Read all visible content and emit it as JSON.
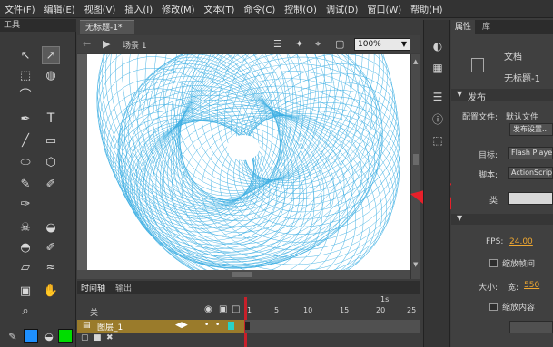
{
  "menubar": {
    "items": [
      "文件(F)",
      "编辑(E)",
      "视图(V)",
      "插入(I)",
      "修改(M)",
      "文本(T)",
      "命令(C)",
      "控制(O)",
      "调试(D)",
      "窗口(W)",
      "帮助(H)"
    ]
  },
  "tools_panel": {
    "title": "工具",
    "icons": [
      "selection-arrow-icon",
      "subselection-arrow-icon",
      "free-transform-icon",
      "3d-rotation-icon",
      "lasso-icon",
      "pen-icon",
      "text-icon",
      "line-icon",
      "rectangle-icon",
      "oval-icon",
      "polystar-icon",
      "pencil-icon",
      "brush-icon",
      "deco-brush-icon",
      "bone-icon",
      "paint-bucket-icon",
      "ink-bottle-icon",
      "eyedropper-icon",
      "eraser-icon",
      "width-tool-icon",
      "camera-icon",
      "hand-icon",
      "zoom-icon",
      "pencil-small-icon"
    ],
    "stroke_color": "#1e90ff",
    "fill_color": "#00dd00"
  },
  "document": {
    "tab_label": "无标题-1*",
    "scene_label": "场景 1",
    "zoom_value": "100%",
    "stage_color": "#ffffff",
    "spiro_color": "#2aa7e0"
  },
  "timeline": {
    "tabs": [
      "时间轴",
      "输出"
    ],
    "layer_folder": "关",
    "layer_name": "图层_1",
    "ruler_ticks": [
      "1",
      "5",
      "10",
      "15",
      "20",
      "25"
    ],
    "ruler_second": "1s"
  },
  "properties": {
    "tabs": [
      "属性",
      "库"
    ],
    "doc_type": "文档",
    "doc_name": "无标题-1",
    "section_publish": "发布",
    "profile_label": "配置文件:",
    "profile_value": "默认文件",
    "publish_settings_button": "发布设置...",
    "target_label": "目标:",
    "target_value": "Flash Player",
    "script_label": "脚本:",
    "script_value": "ActionScript",
    "class_label": "类:",
    "fps_label": "FPS:",
    "fps_value": "24.00",
    "scale_frames_label": "缩放帧间",
    "size_label": "大小:",
    "width_label": "宽:",
    "width_value": "550",
    "scale_content_label": "缩放内容"
  },
  "annotation": {
    "arrow_color": "#e8202a"
  }
}
